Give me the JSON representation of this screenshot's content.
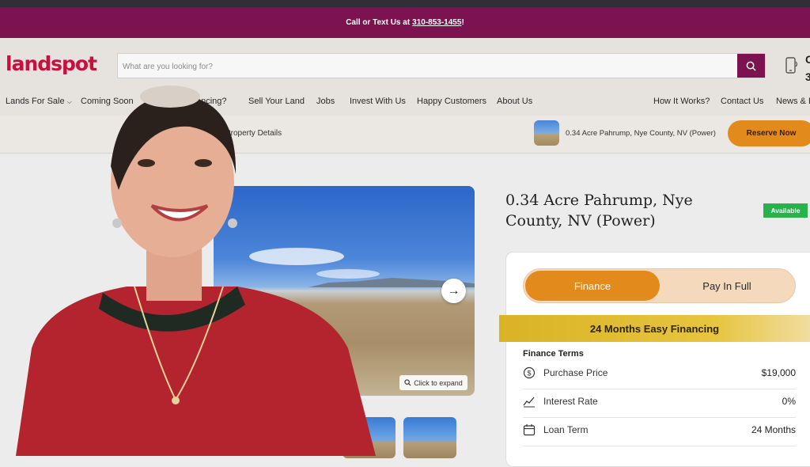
{
  "promo": {
    "prefix": "Call or Text Us at",
    "phone": "310-853-1455",
    "suffix": "!"
  },
  "brand": {
    "logo": "landspot",
    "color": "#c8103e",
    "primary": "#7c1250",
    "accent": "#e38a1c"
  },
  "search": {
    "placeholder": "What are you looking for?",
    "button_icon": "search-icon"
  },
  "cart": {
    "icon": "phone-icon",
    "text_top": "C",
    "text_bottom": "3"
  },
  "nav": {
    "lands_for_sale": "Lands For Sale",
    "coming_soon": "Coming Soon",
    "financing": "ancing?",
    "sell_your_land": "Sell Your Land",
    "jobs": "Jobs",
    "invest_with_us": "Invest With Us",
    "happy_customers": "Happy Customers",
    "about_us": "About Us",
    "how_it_works": "How It Works?",
    "contact_us": "Contact Us",
    "news": "News & B"
  },
  "subbar": {
    "breadcrumb": "Property Details",
    "property_short": "0.34 Acre Pahrump, Nye County, NV (Power)",
    "reserve_label": "Reserve Now"
  },
  "gallery": {
    "expand_label": "Click to expand"
  },
  "listing": {
    "title": "0.34 Acre Pahrump, Nye County, NV (Power)",
    "status": "Available"
  },
  "payment": {
    "tab_finance": "Finance",
    "tab_pay_full": "Pay In Full",
    "banner": "24 Months Easy Financing",
    "terms_heading": "Finance Terms",
    "rows": [
      {
        "label": "Purchase Price",
        "value": "$19,000",
        "icon": "dollar-icon"
      },
      {
        "label": "Interest Rate",
        "value": "0%",
        "icon": "chart-icon"
      },
      {
        "label": "Loan Term",
        "value": "24 Months",
        "icon": "calendar-icon"
      }
    ]
  }
}
